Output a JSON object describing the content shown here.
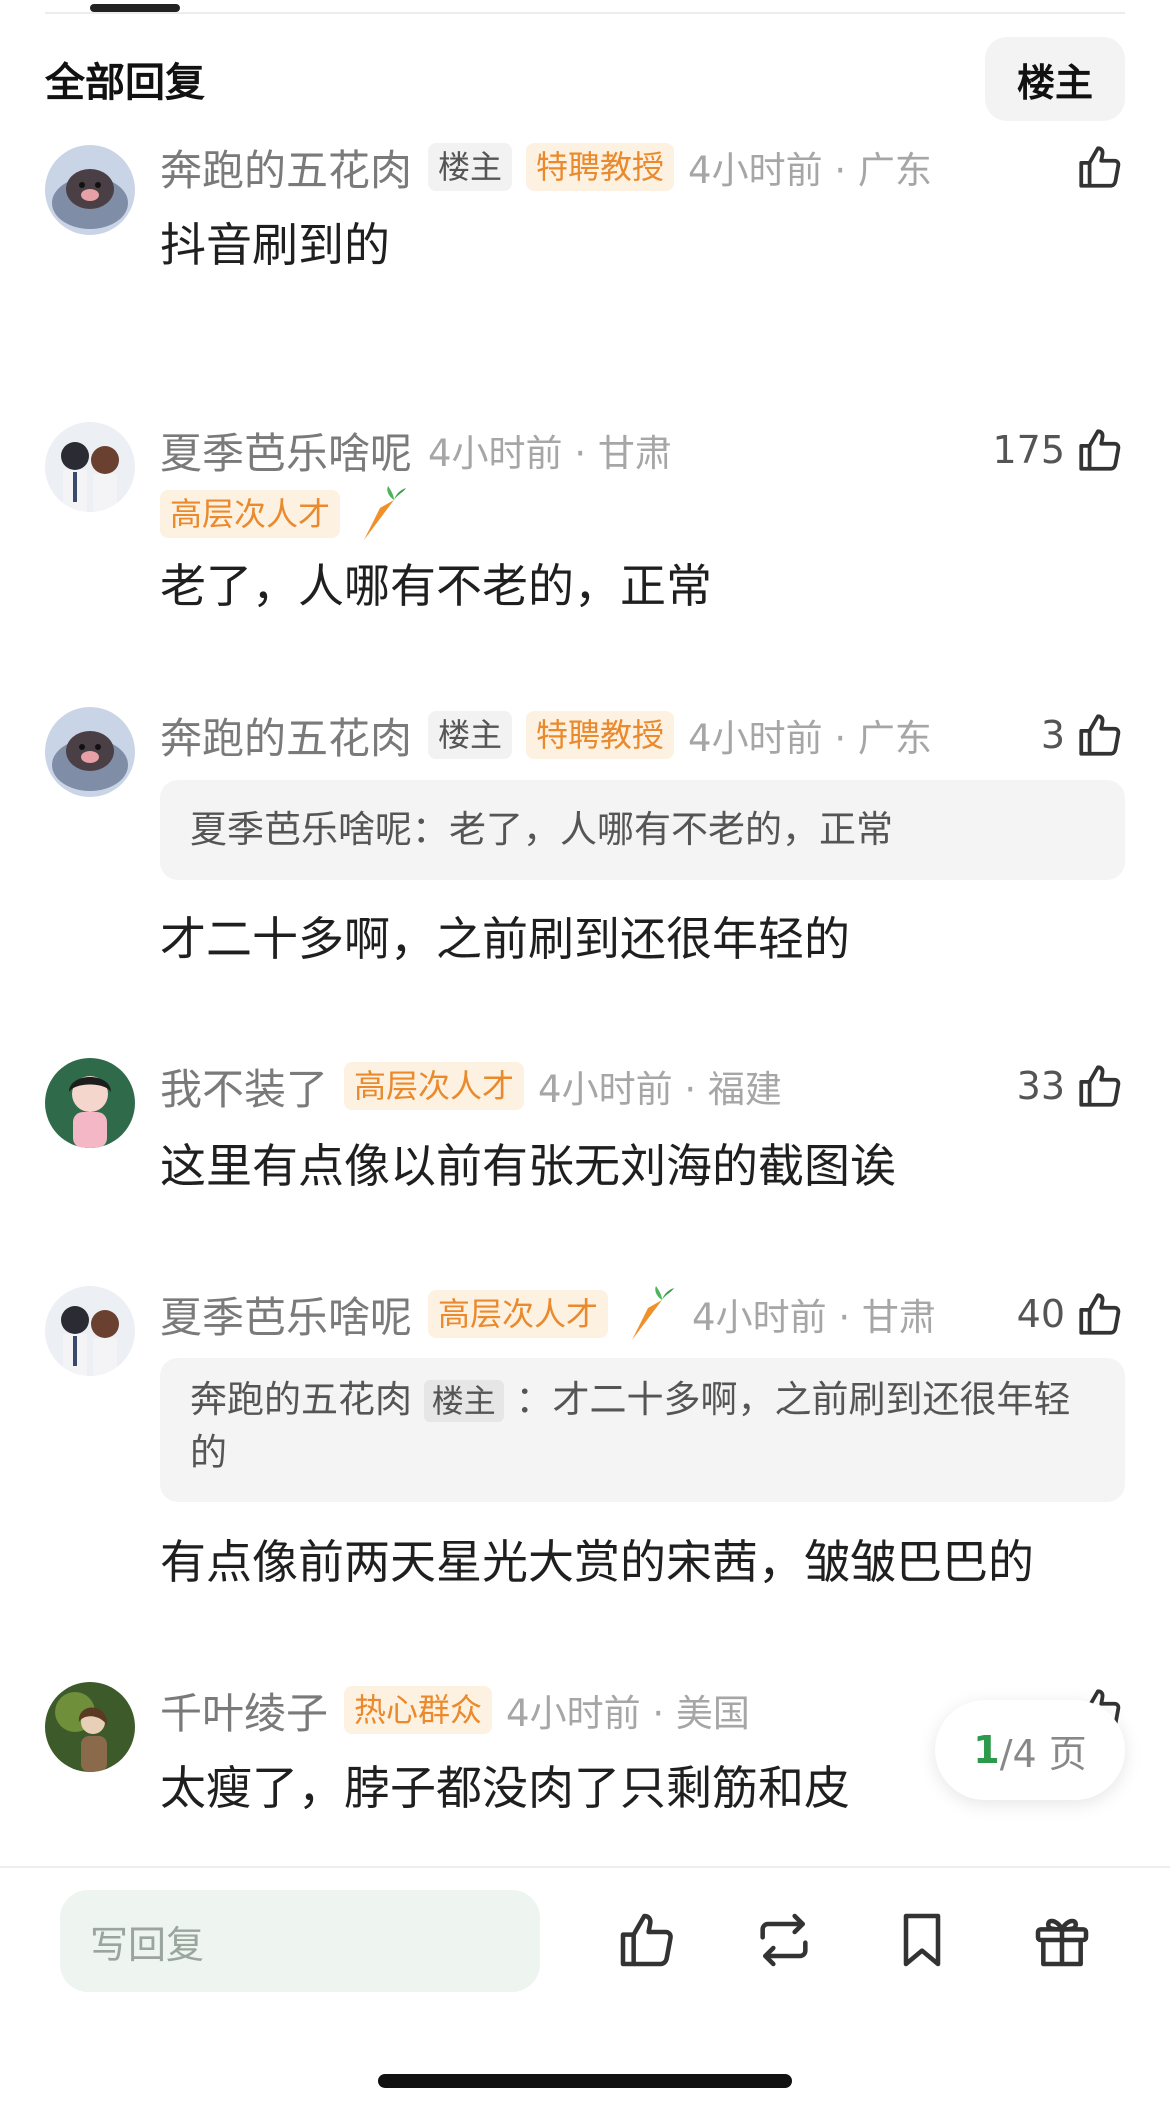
{
  "header": {
    "title": "全部回复",
    "owner_filter_label": "楼主"
  },
  "comments": [
    {
      "username": "奔跑的五花肉",
      "owner_tag": "楼主",
      "badge": "特聘教授",
      "time_location": "4小时前 · 广东",
      "likes": "",
      "text": "抖音刷到的"
    },
    {
      "username": "夏季芭乐啥呢",
      "badge": "高层次人才",
      "time_location": "4小时前 · 甘肃",
      "likes": "175",
      "text": "老了，人哪有不老的，正常"
    },
    {
      "username": "奔跑的五花肉",
      "owner_tag": "楼主",
      "badge": "特聘教授",
      "time_location": "4小时前 · 广东",
      "likes": "3",
      "quote": "夏季芭乐啥呢：老了，人哪有不老的，正常",
      "text": "才二十多啊，之前刷到还很年轻的"
    },
    {
      "username": "我不装了",
      "badge": "高层次人才",
      "time_location": "4小时前 · 福建",
      "likes": "33",
      "text": "这里有点像以前有张无刘海的截图诶"
    },
    {
      "username": "夏季芭乐啥呢",
      "badge": "高层次人才",
      "time_location": "4小时前 · 甘肃",
      "likes": "40",
      "quote_user": "奔跑的五花肉",
      "quote_tag": "楼主",
      "quote_text": "：才二十多啊，之前刷到还很年轻的",
      "text": "有点像前两天星光大赏的宋茜，皱皱巴巴的"
    },
    {
      "username": "千叶绫子",
      "badge": "热心群众",
      "time_location": "4小时前 · 美国",
      "likes": "",
      "text": "太瘦了，脖子都没肉了只剩筋和皮"
    }
  ],
  "pagination": {
    "current": "1",
    "total": "/4 页"
  },
  "bottom_bar": {
    "reply_placeholder": "写回复",
    "icons": [
      "thumbs-up-icon",
      "repost-icon",
      "bookmark-icon",
      "gift-icon"
    ]
  },
  "colors": {
    "badge_orange": "#ea8a2c",
    "page_green": "#2d9a4b",
    "reply_bg": "#eef4ef"
  }
}
